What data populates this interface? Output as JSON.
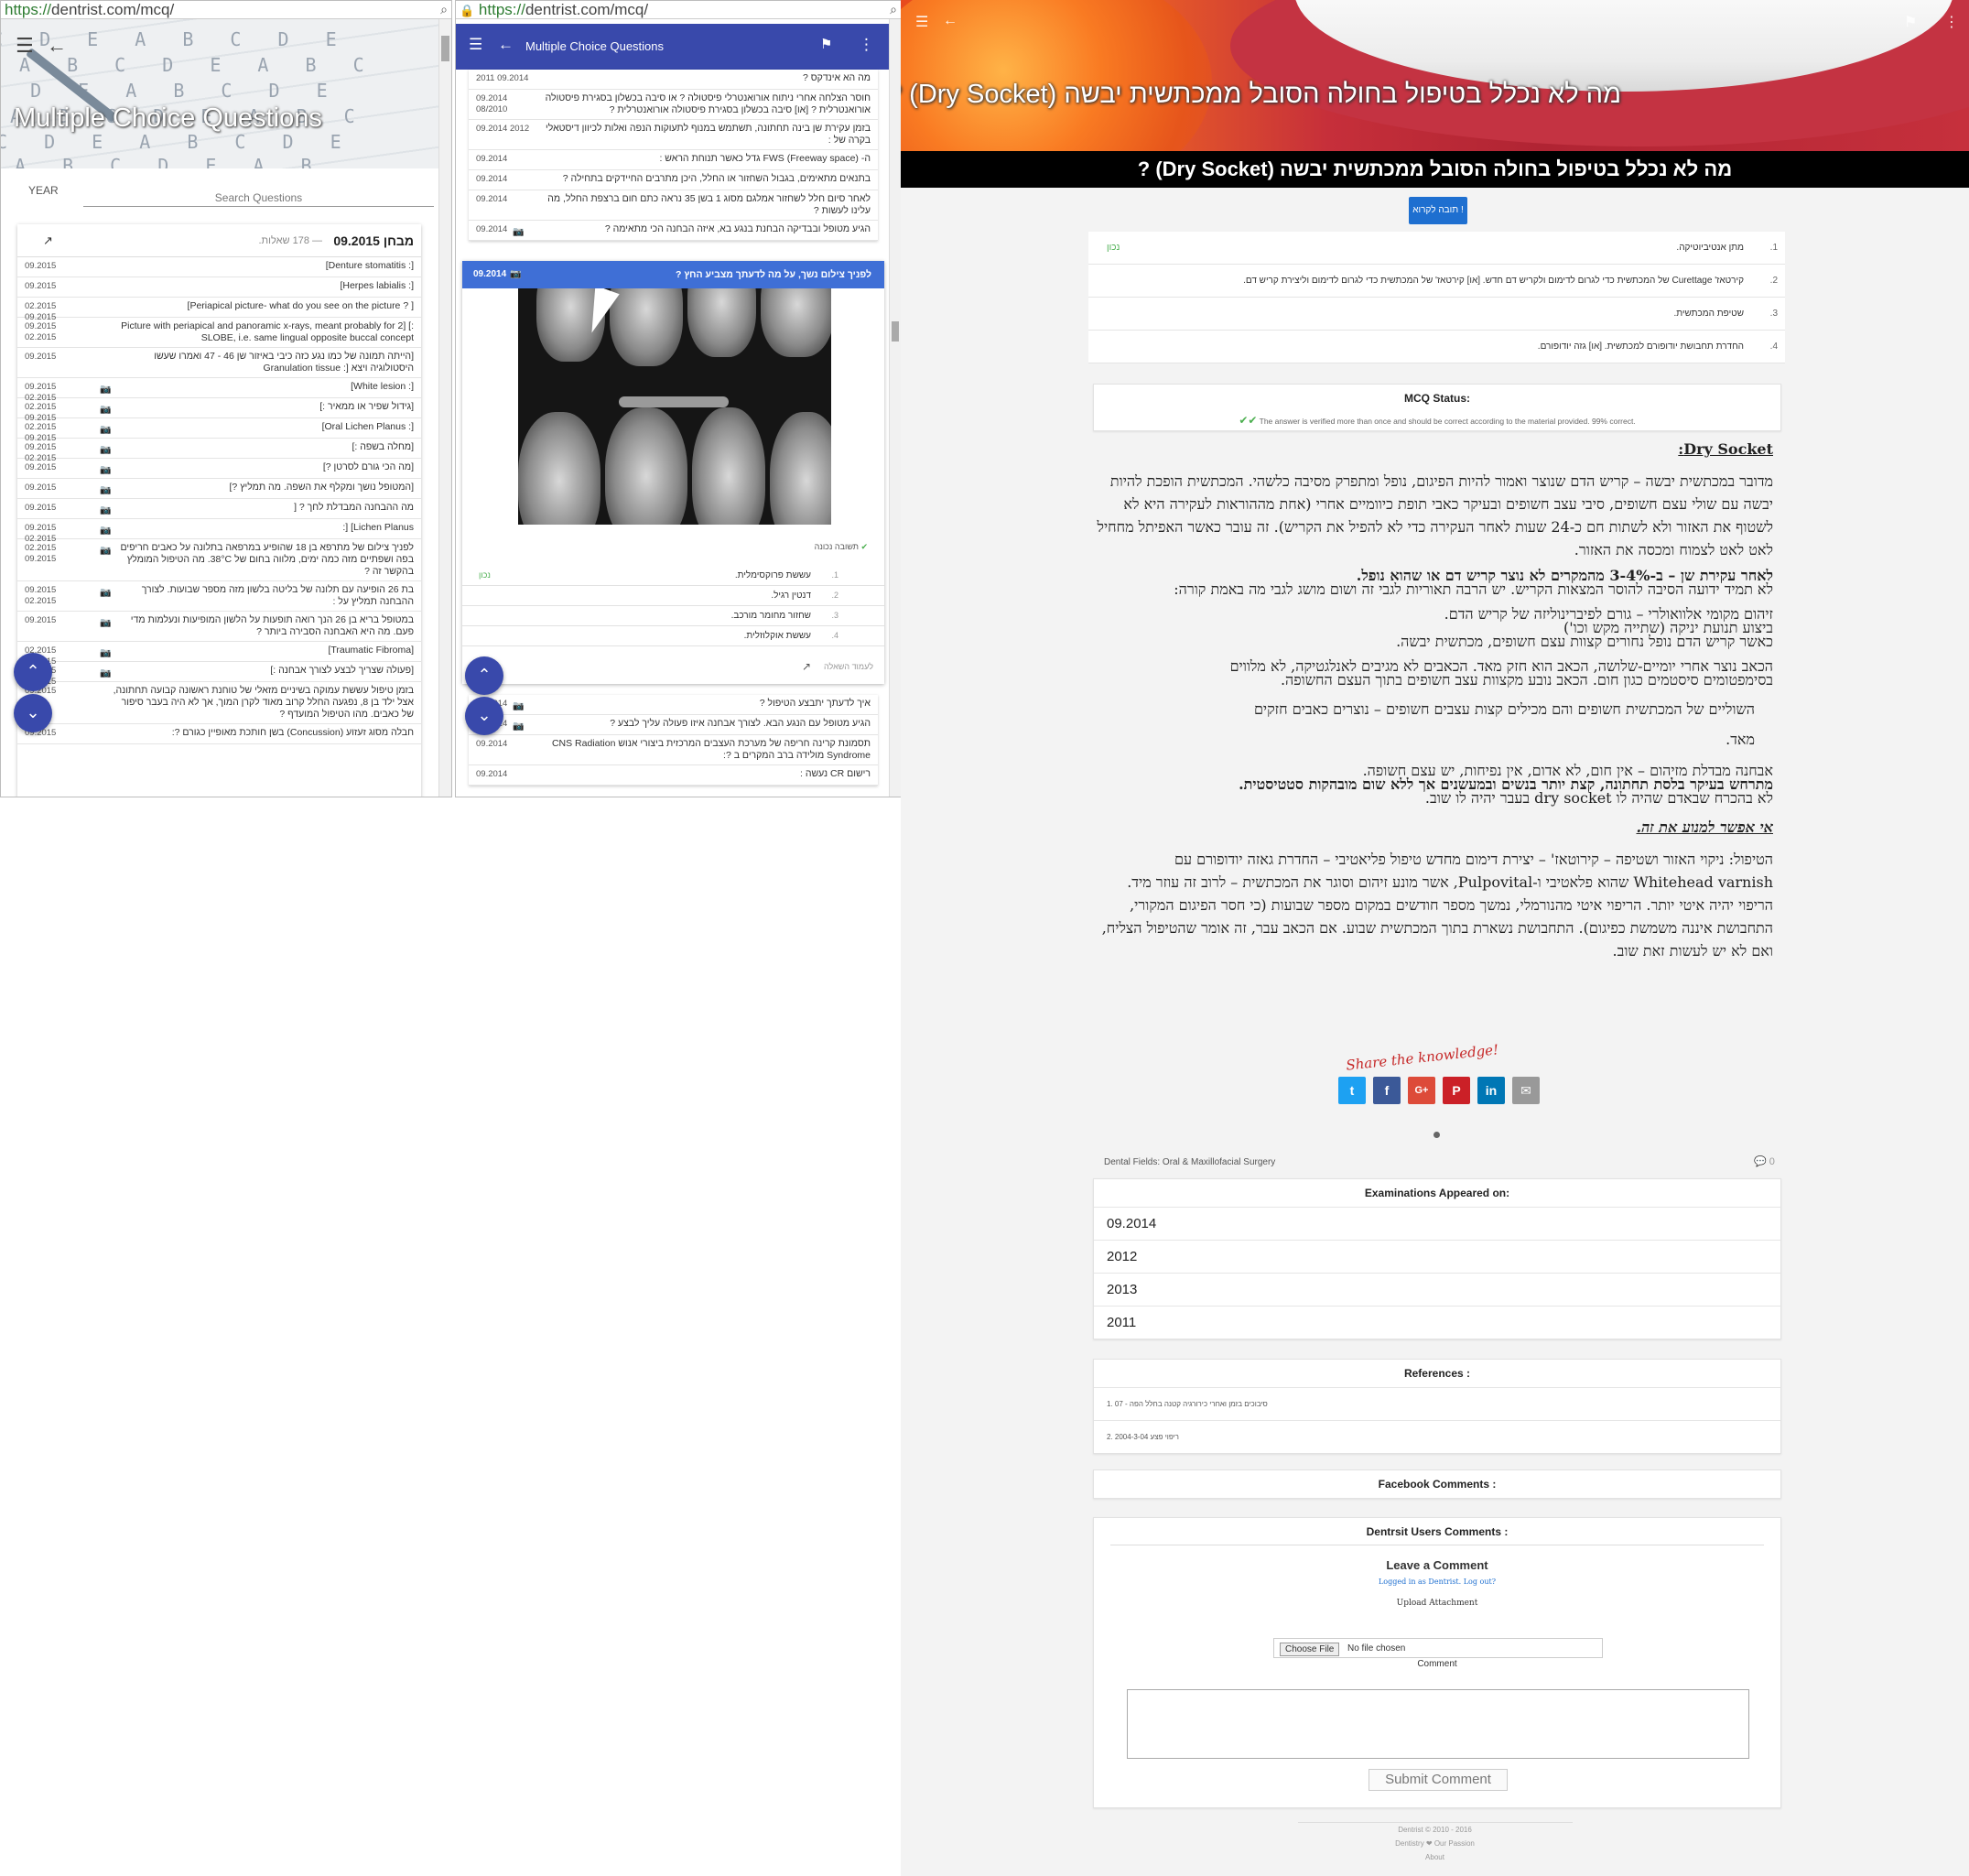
{
  "panel1": {
    "url_prefix": "https://",
    "url_rest": "dentrist.com/mcq/",
    "hero_title": "Multiple Choice Questions",
    "filter_year": "YEAR",
    "search_placeholder": "Search Questions",
    "exam_title": "מבחן 09.2015",
    "exam_count": "— 178 שאלות.",
    "rows": [
      {
        "date": "09.2015",
        "text": "[: Denture stomatitis]",
        "cam": false
      },
      {
        "date": "09.2015",
        "text": "[: Herpes labialis]",
        "cam": false
      },
      {
        "date": "02.2015 09.2015",
        "text": "[ ? Periapical picture- what do you see on the picture]",
        "cam": false
      },
      {
        "date": "09.2015 02.2015",
        "text": "Picture with periapical and panoramic x-rays, meant probably for 2] [: SLOBE, i.e. same lingual opposite buccal concept",
        "cam": false
      },
      {
        "date": "09.2015",
        "text": "[הייתה תמונה של כמו נגע כזה כיבי באיזור שן 46 - 47 ואמרו שעשו היסטולוגיה ויצא [: Granulation tissue",
        "cam": false
      },
      {
        "date": "09.2015 02.2015",
        "text": "[: White lesion]",
        "cam": true
      },
      {
        "date": "02.2015 09.2015",
        "text": "[גידול שפיר או ממאיר :]",
        "cam": true
      },
      {
        "date": "02.2015 09.2015",
        "text": "[: Oral Lichen Planus]",
        "cam": true
      },
      {
        "date": "09.2015 02.2015",
        "text": "[מחלה בשפה :]",
        "cam": true
      },
      {
        "date": "09.2015",
        "text": "[מה הכי גורם לסרטן ?]",
        "cam": true
      },
      {
        "date": "09.2015",
        "text": "[המטופל נושך ומקלף את השפה. מה תמליץ ?]",
        "cam": true
      },
      {
        "date": "09.2015",
        "text": "מה ההבחנה המבדלת לחך ? [",
        "cam": true
      },
      {
        "date": "09.2015 02.2015",
        "text": "Lichen Planus] [:",
        "cam": true
      },
      {
        "date": "02.2015 09.2015",
        "text": "לפניך צילום של מתרפא בן 18 שהופיע במרפאה בתלונה על כאבים חריפים בפה ושפתיים מזה כמה ימים, מלווה בחום של 38°C. מה הטיפול המומלץ בהקשר זה ?",
        "cam": true
      },
      {
        "date": "09.2015 02.2015",
        "text": "בת 26 הופיעה עם תלונה של בליטה בלשון מזה מספר שבועות. לצורך ההבחנה תמליץ על :",
        "cam": true
      },
      {
        "date": "09.2015",
        "text": "במטופל בריא בן 26 הנך רואה תופעות על הלשון המופיעות ונעלמות מדי פעם. מה היא האבחנה הסבירה ביותר ?",
        "cam": true
      },
      {
        "date": "02.2015 09.2015",
        "text": "[Traumatic Fibroma]",
        "cam": true
      },
      {
        "date": "02.2015 09.2015",
        "text": "[פעולה שצריך לבצע לצורך אבחנה :]",
        "cam": true
      },
      {
        "date": "09.2015",
        "text": "בזמן טיפול עששת עמוקה בשיניים מזאלי של טוחנת ראשונה קבועה תחתונה, אצל ילד בן 8, נפגעה החלל קרוב מאוד לקרן המוך, אך לא היה בעבר סיפור של כאבים. מהו הטיפול המועדף ?",
        "cam": false
      },
      {
        "date": "09.2015",
        "text": "חבלה מסוג זעזוע (Concussion) בשן חותכת מאופיין כגורם ?:",
        "cam": false
      }
    ]
  },
  "panel2": {
    "url_prefix": "https://",
    "url_rest": "dentrist.com/mcq/",
    "bar_title": "Multiple Choice Questions",
    "list_top": [
      {
        "date": "2011 09.2014",
        "text": "מה הא אינדקס ?"
      },
      {
        "date": "09.2014 08/2010",
        "text": "חוסר הצלחה אחרי ניתוח אורואנטרלי פיסטולה ? או סיבה בכשלון בסגירת פיסטולה אורואנטרלית ? [או] סיבה בכשלון בסגירת פיסטולה אורואנטרלית ?"
      },
      {
        "date": "09.2014 2012",
        "text": "בזמן עקירת שן בינה תחתונה, תשתמש במנוף לתעוקות הנפה ואלות לכיוון דיסטאלי בקרה של :"
      },
      {
        "date": "09.2014",
        "text": "ה- FWS (Freeway space) גדל כאשר תנוחת הראש :"
      },
      {
        "date": "09.2014",
        "text": "בתנאים מתאימים, בגבול השחזור או החלל, היכן מתרבים החיידקים בתחילה ?"
      },
      {
        "date": "09.2014",
        "text": "לאחר סיום חלל לשחזור אמלגם מסוג 1 בשן 35 נראה כתם חום ברצפת החלל, מה עלינו לעשות ?"
      },
      {
        "date": "09.2014",
        "text": "הגיע מטופל ובבדיקה הבחנת בנגע בא, איזה הבחנה הכי מתאימה ?",
        "cam": true
      }
    ],
    "qcard": {
      "date": "09.2014",
      "question": "לפניך צילום נשך, על מה לדעתך מצביע החץ ?",
      "verified": "תשובה נכונה",
      "answers": [
        {
          "n": "1.",
          "text": "עששת פרוקסימלית.",
          "correct": "נכון"
        },
        {
          "n": "2.",
          "text": "דנטין רגיל.",
          "correct": ""
        },
        {
          "n": "3.",
          "text": "שחזור מחומר מורכב.",
          "correct": ""
        },
        {
          "n": "4.",
          "text": "עששת אוקלוזלית.",
          "correct": ""
        }
      ],
      "footer": "לעמוד השאלה"
    },
    "list_bottom": [
      {
        "date": "09.2014",
        "text": "איך לדעתך יתבצע הטיפול ?",
        "cam": true
      },
      {
        "date": "09.2014",
        "text": "הגיע מטופל עם הנגע הבא. לצורך אבחנה איזו פעולה עליך לבצע ?",
        "cam": true
      },
      {
        "date": "09.2014",
        "text": "תסמונת קרינה חריפה של מערכת העצבים המרכזית ביצורי אנוש CNS Radiation Syndrome מולידה ברב המקרים ב ?:",
        "cam": false
      },
      {
        "date": "09.2014",
        "text": "רישום CR נעשה :",
        "cam": false
      }
    ]
  },
  "panel3": {
    "hero_title": "מה לא נכלל בטיפול בחולה הסובל ממכתשית יבשה (Dry Socket) ?",
    "page_title": "מה לא נכלל בטיפול בחולה הסובל ממכתשית יבשה (Dry Socket) ?",
    "check_button": "תובה לקרוא !",
    "options": [
      {
        "n": "1.",
        "text": "מתן אנטיביוטיקה.",
        "correct": "נכון"
      },
      {
        "n": "2.",
        "text": "קירטאז' Curettage של המכתשית כדי לגרום לדימום ולקריש דם חדש. [או] קירטאז' של המכתשית כדי לגרום לדימום וליצירת קריש דם.",
        "correct": ""
      },
      {
        "n": "3.",
        "text": "שטיפת המכתשית.",
        "correct": ""
      },
      {
        "n": "4.",
        "text": "החדרת תחבושת יודופורם למכתשית. [או] גזה יודופורם.",
        "correct": ""
      }
    ],
    "mcq_status_title": "MCQ Status:",
    "mcq_status_text": "The answer is verified more than once and should be correct according to the material provided. 99% correct.",
    "article": {
      "heading": "Dry Socket:",
      "p1": "מדובר במכתשית יבשה – קריש הדם שנוצר ואמור להיות הפיגום, נופל ומתפרק מסיבה כלשהי. המכתשית הופכת להיות יבשה עם שולי עצם חשופים, סיבי עצב חשופים ובעיקר כאבי תופת כיוומיים אחרי (אחת מההוראות לעקירה היא לא לשטוף את האזור ולא לשתות חם כ-24 שעות לאחר העקירה כדי לא להפיל את הקריש). זה עובר כאשר האפיתל מחחיל לאט לאט לצמוח ומכסה את האזור.",
      "p2a": "לאחר עקירת שן – ב-3-4% מהמקרים לא נוצר קריש דם או שהוא נופל.",
      "p2b": "לא תמיד ידועה הסיבה להוסר המצאות הקריש. יש הרבה תאוריות לגבי זה ושום מושג לגבי מה באמת קורה:",
      "p3a": "זיהום מקומי אלוואולרי – גורם לפיברינוליזה של קריש הדם.",
      "p3b": "ביצוע תנועת יניקה (שתייה מקש וכו')",
      "p3c": "כאשר קריש הדם נופל נחורים קצוות עצם חשופים, מכתשית יבשה.",
      "p4a": "הכאב נוצר אחרי יומיים-שלושה, הכאב הוא חזק מאד. הכאבים לא מגיבים לאנלגטיקה, לא מלווים",
      "p4b": "בסימפטומים סיסטמים כגון חום. הכאב נובע מקצוות עצב חשופים בתוך העצם החשופה.",
      "p5": "השוליים של המכתשית חשופים והם מכילים קצות עצבים חשופים – נוצרים כאבים חזקים",
      "p5b": "מאד.",
      "p6a": "אבחנה מבדלת מזיהום – אין חום, לא אדום, אין נפיחות, יש עצם חשופה.",
      "p6b": "מתרחש בעיקר בלסת תחתונה, קצת יותר בנשים ובמעשנים אך ללא שום מובהקות סטטיסטית.",
      "p6c": "לא בהכרח שבאדם שהיה לו dry socket בעבר יהיה לו שוב.",
      "heading2": "אי אפשר למנוע את זה.",
      "p7": "הטיפול: ניקוי האזור ושטיפה – קירוטאז' – יצירת דימום מחדש טיפול פליאטיבי – החדרת גאזה יודופורם עם Whitehead varnish שהוא פלאטיבי ו-Pulpovital, אשר מונע זיהום וסוגר את המכתשית – לרוב זה עוזר מיד. הריפוי יהיה איטי יותר. הריפוי איטי מהנורמלי, נמשך מספר חודשים במקום מספר שבועות (כי חסר הפיגום המקורי, התחבושת איננה משמשת כפיגום). התחבושת נשארת בתוך המכתשית שבוע. אם הכאב עבר, זה אומר שהטיפול הצליח, ואם לא יש לעשות זאת שוב."
    },
    "share_label": "Share the knowledge!",
    "share_icons": [
      "twitter-icon",
      "facebook-icon",
      "google-plus-icon",
      "pinterest-icon",
      "linkedin-icon",
      "email-icon"
    ],
    "dental_fields": "Dental Fields: Oral & Maxillofacial Surgery",
    "comment_count": "0",
    "exams_title": "Examinations Appeared on:",
    "exams": [
      "09.2014",
      "2012",
      "2013",
      "2011"
    ],
    "refs_title": "References :",
    "refs": [
      "1. 07 - סיבוכים בזמן ואחרי כירורגיה קטנה בחלל הפה",
      "2. 2004-3-04 ריפוי פצע"
    ],
    "fb_title": "Facebook Comments :",
    "users_title": "Dentrsit Users Comments :",
    "leave_comment": "Leave a Comment",
    "logged_in": "Logged in as Dentrist. Log out?",
    "upload": "Upload Attachment",
    "choose_file": "Choose File",
    "no_file": "No file chosen",
    "comment_label": "Comment",
    "submit": "Submit Comment",
    "footer1": "Dentrist © 2010 - 2016",
    "footer2": "Dentistry ❤ Our Passion",
    "footer3": "About"
  }
}
